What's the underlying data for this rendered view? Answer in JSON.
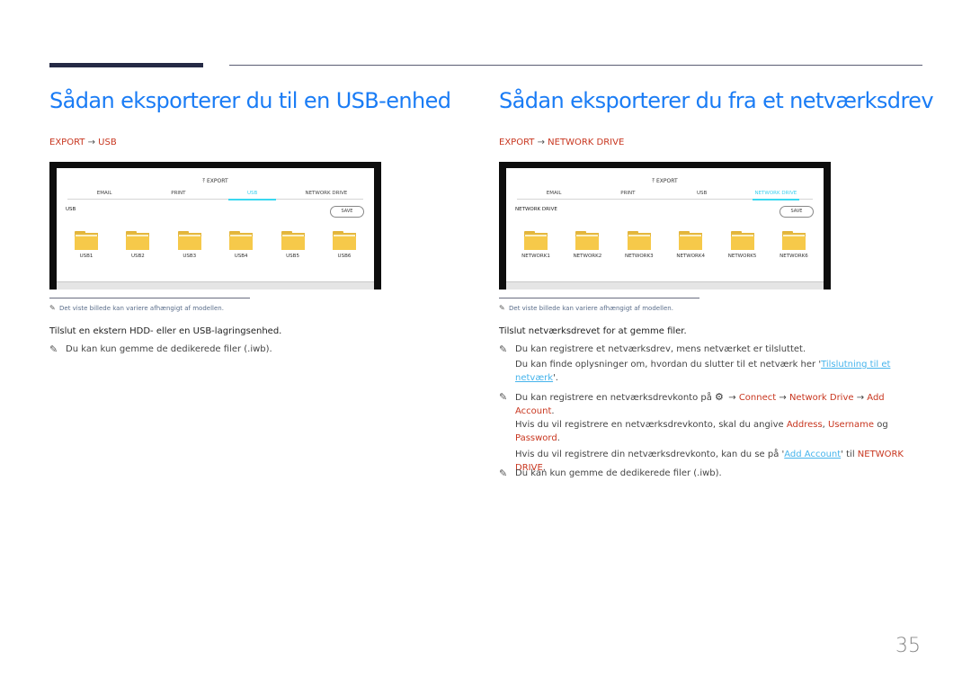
{
  "page_number": "35",
  "left": {
    "title": "Sådan eksporterer du til en USB-enhed",
    "path": {
      "part1": "EXPORT",
      "arrow": "→",
      "part2": "USB"
    },
    "screen": {
      "header": "EXPORT",
      "tabs": [
        {
          "label": "EMAIL",
          "active": false
        },
        {
          "label": "PRINT",
          "active": false
        },
        {
          "label": "USB",
          "active": true
        },
        {
          "label": "NETWORK DRIVE",
          "active": false
        }
      ],
      "section_label": "USB",
      "save_label": "SAVE",
      "folders": [
        "USB1",
        "USB2",
        "USB3",
        "USB4",
        "USB5",
        "USB6"
      ]
    },
    "image_note": "Det viste billede kan variere afhængigt af modellen.",
    "instruction": "Tilslut en ekstern HDD- eller en USB-lagringsenhed.",
    "notes": [
      "Du kan kun gemme de dedikerede filer (.iwb)."
    ]
  },
  "right": {
    "title": "Sådan eksporterer du fra et netværksdrev",
    "path": {
      "part1": "EXPORT",
      "arrow": "→",
      "part2": "NETWORK DRIVE"
    },
    "screen": {
      "header": "EXPORT",
      "tabs": [
        {
          "label": "EMAIL",
          "active": false
        },
        {
          "label": "PRINT",
          "active": false
        },
        {
          "label": "USB",
          "active": false
        },
        {
          "label": "NETWORK DRIVE",
          "active": true
        }
      ],
      "section_label": "NETWORK DRIVE",
      "save_label": "SAVE",
      "folders": [
        "NETWORK1",
        "NETWORK2",
        "NETWORK3",
        "NETWORK4",
        "NETWORK5",
        "NETWORK6"
      ]
    },
    "image_note": "Det viste billede kan variere afhængigt af modellen.",
    "instruction": "Tilslut netværksdrevet for at gemme filer.",
    "note1": {
      "line1": "Du kan registrere et netværksdrev, mens netværket er tilsluttet.",
      "line2_pre": "Du kan finde oplysninger om, hvordan du slutter til et netværk her '",
      "link": "Tilslutning til et netværk",
      "line2_post": "'."
    },
    "note2": {
      "pre": "Du kan registrere en netværksdrevkonto på ",
      "menu": [
        "Connect",
        "Network Drive",
        "Add Account"
      ],
      "arrow": "→",
      "line2_pre": "Hvis du vil registrere en netværksdrevkonto, skal du angive ",
      "fields": [
        "Address",
        "Username",
        "Password"
      ],
      "comma": ", ",
      "og": " og ",
      "line3_pre": "Hvis du vil registrere din netværksdrevkonto, kan du se på '",
      "link": "Add Account",
      "line3_mid": "' til ",
      "target": "NETWORK DRIVE",
      "period": "."
    },
    "note3": "Du kan kun gemme de dedikerede filer (.iwb)."
  },
  "colors": {
    "title": "#1a7cf5",
    "path": "#c8361f",
    "active_tab": "#3ad0f0",
    "link": "#46b4ec"
  }
}
